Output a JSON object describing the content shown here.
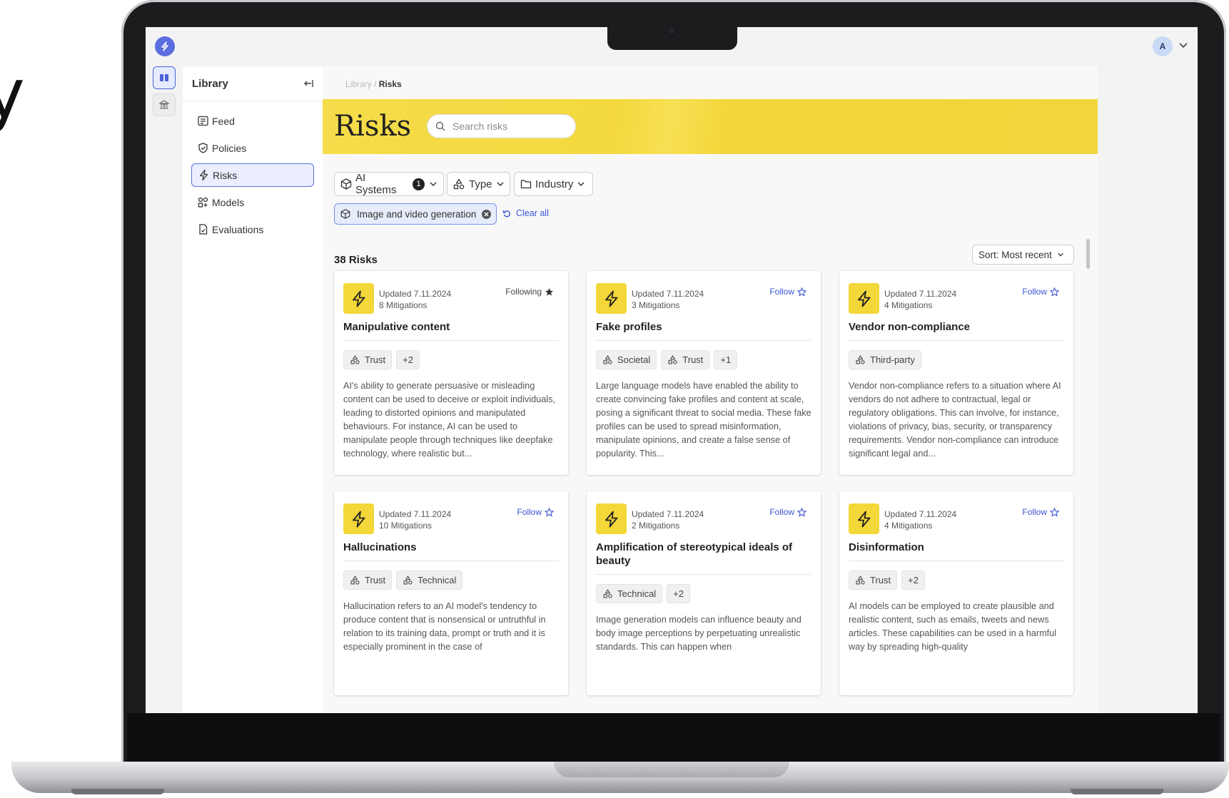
{
  "background_fragment": "y",
  "app": {
    "avatar_initial": "A"
  },
  "sidebar": {
    "title": "Library",
    "items": [
      {
        "label": "Feed",
        "icon": "feed-icon"
      },
      {
        "label": "Policies",
        "icon": "shield-icon"
      },
      {
        "label": "Risks",
        "icon": "lightning-icon",
        "active": true
      },
      {
        "label": "Models",
        "icon": "models-icon"
      },
      {
        "label": "Evaluations",
        "icon": "evaluation-icon"
      }
    ]
  },
  "breadcrumb": {
    "parent": "Library",
    "separator": " / ",
    "current": "Risks"
  },
  "page": {
    "title": "Risks",
    "search_placeholder": "Search risks"
  },
  "filters": {
    "ai_systems": {
      "label": "AI Systems",
      "count": "1"
    },
    "type": {
      "label": "Type"
    },
    "industry": {
      "label": "Industry"
    }
  },
  "active_filter": {
    "label": "Image and video generation",
    "clear_label": "Clear all"
  },
  "results": {
    "count_label": "38 Risks",
    "sort_label": "Sort: Most recent"
  },
  "cards": [
    {
      "updated": "Updated 7.11.2024",
      "mitigations": "8 Mitigations",
      "follow": "Following",
      "following": true,
      "title": "Manipulative content",
      "tags": [
        "Trust",
        "+2"
      ],
      "description": "AI's ability to generate persuasive or misleading content can be used to deceive or exploit individuals, leading to distorted opinions and manipulated behaviours. For instance, AI can be used to manipulate people through techniques like deepfake technology, where realistic but..."
    },
    {
      "updated": "Updated 7.11.2024",
      "mitigations": "3 Mitigations",
      "follow": "Follow",
      "following": false,
      "title": "Fake profiles",
      "tags": [
        "Societal",
        "Trust",
        "+1"
      ],
      "description": "Large language models have enabled the ability to create convincing fake profiles and content at scale, posing a significant threat to social media. These fake profiles can be used to spread misinformation, manipulate opinions, and create a false sense of popularity. This..."
    },
    {
      "updated": "Updated 7.11.2024",
      "mitigations": "4 Mitigations",
      "follow": "Follow",
      "following": false,
      "title": "Vendor non-compliance",
      "tags": [
        "Third-party"
      ],
      "description": "Vendor non-compliance refers to a situation where AI vendors do not adhere to contractual, legal or regulatory obligations. This can involve, for instance, violations of privacy, bias, security, or transparency requirements. Vendor non-compliance can introduce significant legal and..."
    },
    {
      "updated": "Updated 7.11.2024",
      "mitigations": "10 Mitigations",
      "follow": "Follow",
      "following": false,
      "title": "Hallucinations",
      "tags": [
        "Trust",
        "Technical"
      ],
      "description": "Hallucination refers to an AI model's tendency to produce content that is nonsensical or untruthful in relation to its training data, prompt or truth and it is especially prominent in the case of"
    },
    {
      "updated": "Updated 7.11.2024",
      "mitigations": "2 Mitigations",
      "follow": "Follow",
      "following": false,
      "title": "Amplification of stereotypical ideals of beauty",
      "tags": [
        "Technical",
        "+2"
      ],
      "description": "Image generation models can influence beauty and body image perceptions by perpetuating unrealistic standards. This can happen when"
    },
    {
      "updated": "Updated 7.11.2024",
      "mitigations": "4 Mitigations",
      "follow": "Follow",
      "following": false,
      "title": "Disinformation",
      "tags": [
        "Trust",
        "+2"
      ],
      "description": "AI models can be employed to create plausible and realistic content, such as emails, tweets and news articles. These capabilities can be used in a harmful way by spreading high-quality"
    }
  ],
  "colors": {
    "accent": "#4b63d8",
    "banner": "#f3d93f",
    "risk_icon_bg": "#f4d738"
  }
}
